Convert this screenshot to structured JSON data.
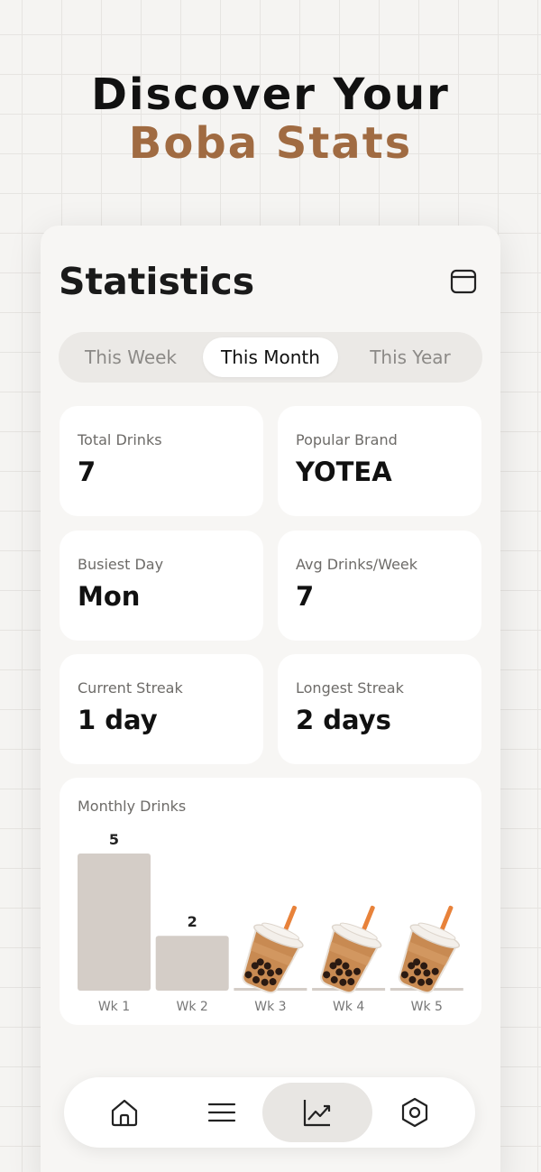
{
  "headline": {
    "line1": "Discover Your",
    "line2": "Boba Stats"
  },
  "screen": {
    "title": "Statistics",
    "calendar_icon": "calendar-icon"
  },
  "tabs": [
    {
      "label": "This Week",
      "active": false
    },
    {
      "label": "This Month",
      "active": true
    },
    {
      "label": "This Year",
      "active": false
    }
  ],
  "stats": {
    "total_drinks": {
      "label": "Total Drinks",
      "value": "7"
    },
    "popular_brand": {
      "label": "Popular Brand",
      "value": "YOTEA"
    },
    "busiest_day": {
      "label": "Busiest Day",
      "value": "Mon"
    },
    "avg_per_week": {
      "label": "Avg Drinks/Week",
      "value": "7"
    },
    "current_streak": {
      "label": "Current Streak",
      "value": "1 day"
    },
    "longest_streak": {
      "label": "Longest Streak",
      "value": "2 days"
    }
  },
  "chart_data": {
    "type": "bar",
    "title": "Monthly Drinks",
    "categories": [
      "Wk 1",
      "Wk 2",
      "Wk 3",
      "Wk 4",
      "Wk 5"
    ],
    "values": [
      5,
      2,
      0,
      0,
      0
    ],
    "ylim": [
      0,
      5
    ],
    "bar_color": "#d4cdc7",
    "empty_placeholder_icon": "boba-tea-icon"
  },
  "nav": [
    {
      "icon": "home-icon",
      "active": false
    },
    {
      "icon": "list-icon",
      "active": false
    },
    {
      "icon": "chart-icon",
      "active": true
    },
    {
      "icon": "settings-icon",
      "active": false
    }
  ],
  "colors": {
    "accent_brown": "#a06b42",
    "text_dark": "#111111",
    "muted": "#6d6b68"
  }
}
